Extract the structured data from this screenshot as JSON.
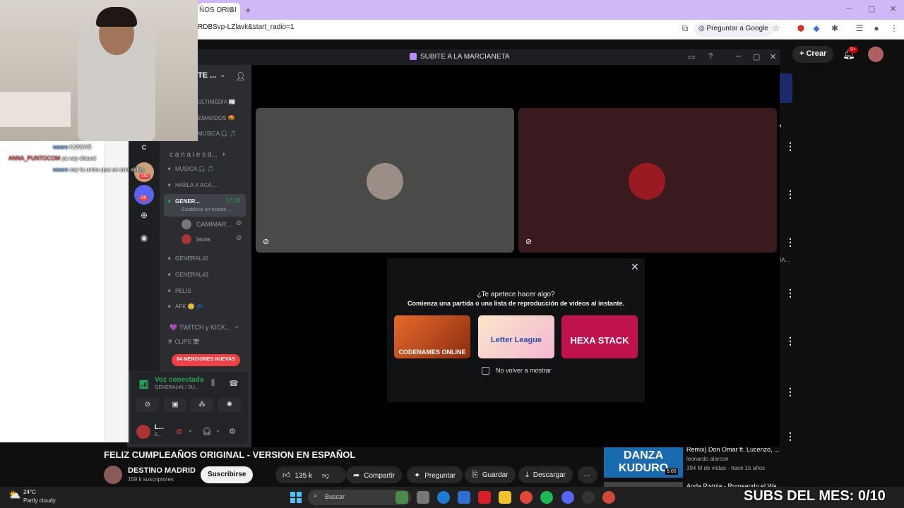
{
  "browser": {
    "tab_title": "ÑOS ORIGI",
    "tab_close": "×",
    "new_tab": "+",
    "url": "RDBSvp-LZlavk&start_radio=1",
    "ask_google": "Preguntar a Google"
  },
  "youtube": {
    "create_label": "Crear",
    "notif_badge": "9+",
    "video_title": "FELIZ CUMPLEAÑOS ORIGINAL - VERSION EN ESPAÑOL",
    "channel_name": "DESTINO MADRID",
    "channel_subs": "159 k suscriptores",
    "subscribe": "Suscribirse",
    "likes": "135 k",
    "share": "Compartir",
    "ask": "Preguntar",
    "save": "Guardar",
    "download": "Descargar",
    "more": "…",
    "recommended": {
      "thumb_text": "DANZA KUDURO",
      "duration": "6:00",
      "title": "Remix) Don Omar ft. Lucenzo, ...",
      "channel": "leonardo alarcon",
      "meta": "394 M de vistas · hace 15 años",
      "title2": "Anda Pistola - Rumeando el Wa..."
    },
    "side_text": "IA..."
  },
  "discord": {
    "window_title": "SUBITE A LA MARCIANETA",
    "server_name": "TE ...",
    "channels_top": [
      "ULTIMEDIA 📰",
      "EMARDOS 🤬",
      "MUSICA 🎧 🎵"
    ],
    "category1": "c a n a l e s  d...",
    "voice_channels": [
      "MUSICA 🎧 🎵",
      "HABLA X ACA ...",
      "GENERAL#2",
      "GENERAL#3",
      "PELIS",
      "AFK 😴 💤"
    ],
    "active_channel": "GENER...",
    "active_timer": "17:20",
    "active_status": "Establece un estado ...",
    "members": [
      "CAMIMAR...",
      "lauta"
    ],
    "category2": "💜 TWITCH y KICK...",
    "text_channel": "CLIPS 🎬",
    "server_c": "C",
    "server_badges": [
      "182",
      "59"
    ],
    "mentions": "84 MENCIONES NUEVAS",
    "voice_status": "Voz conectada",
    "voice_channel_info": "GENERAL#1 / SU...",
    "user_name": "L...",
    "user_status": "E...",
    "activity": {
      "question": "¿Te apetece hacer algo?",
      "subtitle": "Comienza una partida o una lista de reproducción de vídeos al instante.",
      "games": [
        "CODENAMES ONLINE",
        "Letter League",
        "HEXA STACK"
      ],
      "dont_show": "No volver a mostrar"
    }
  },
  "stream_overlay": {
    "chat": [
      {
        "user": "wsaro",
        "text": "KJAKAS"
      },
      {
        "user": "ANNA_PUNTOCOM",
        "text": "ya voy chaval"
      },
      {
        "user": "wsaro",
        "text": "soy la unica que se uno aldas"
      }
    ],
    "subs_banner": "SUBS DEL MES: 0/10"
  },
  "taskbar": {
    "weather_temp": "24°C",
    "weather_desc": "Partly cloudy",
    "search_placeholder": "Buscar"
  },
  "colors": {
    "chrome_tabbar": "#cfb8f5",
    "discord_bg": "#2b2d31",
    "voice_green": "#23a55a",
    "mention_red": "#f23f43",
    "yt_bg": "#0f0f0f"
  }
}
